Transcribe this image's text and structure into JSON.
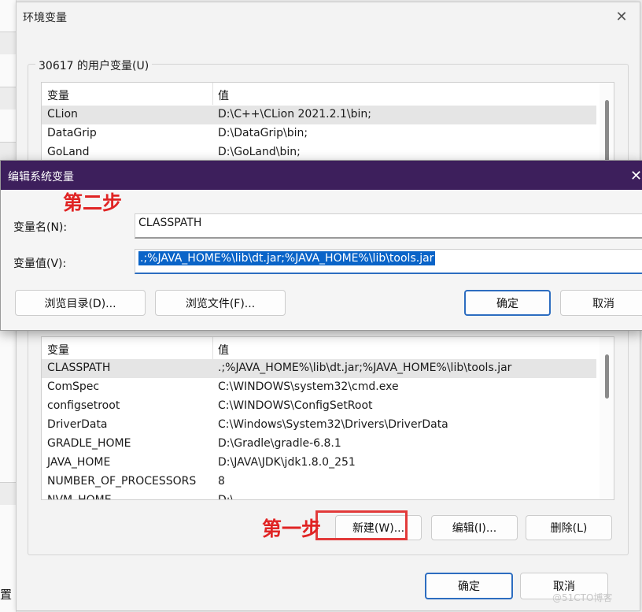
{
  "background": {
    "fragment_text": "置"
  },
  "env_dialog": {
    "title": "环境变量",
    "close_glyph": "✕",
    "user_group_label": "30617 的用户变量(U)",
    "user_table": {
      "headers": [
        "变量",
        "值"
      ],
      "rows": [
        {
          "name": "CLion",
          "value": "D:\\C++\\CLion 2021.2.1\\bin;"
        },
        {
          "name": "DataGrip",
          "value": "D:\\DataGrip\\bin;"
        },
        {
          "name": "GoLand",
          "value": "D:\\GoLand\\bin;"
        }
      ]
    },
    "system_table": {
      "headers": [
        "变量",
        "值"
      ],
      "rows": [
        {
          "name": "CLASSPATH",
          "value": ".;%JAVA_HOME%\\lib\\dt.jar;%JAVA_HOME%\\lib\\tools.jar"
        },
        {
          "name": "ComSpec",
          "value": "C:\\WINDOWS\\system32\\cmd.exe"
        },
        {
          "name": "configsetroot",
          "value": "C:\\WINDOWS\\ConfigSetRoot"
        },
        {
          "name": "DriverData",
          "value": "C:\\Windows\\System32\\Drivers\\DriverData"
        },
        {
          "name": "GRADLE_HOME",
          "value": "D:\\Gradle\\gradle-6.8.1"
        },
        {
          "name": "JAVA_HOME",
          "value": "D:\\JAVA\\JDK\\jdk1.8.0_251"
        },
        {
          "name": "NUMBER_OF_PROCESSORS",
          "value": "8"
        },
        {
          "name": "NVM_HOME",
          "value": "D:\\"
        }
      ]
    },
    "buttons": {
      "new": "新建(W)...",
      "edit": "编辑(I)...",
      "delete": "删除(L)",
      "ok": "确定",
      "cancel": "取消"
    }
  },
  "edit_dialog": {
    "title": "编辑系统变量",
    "close_glyph": "✕",
    "name_label": "变量名(N):",
    "name_value": "CLASSPATH",
    "value_label": "变量值(V):",
    "value_value": ".;%JAVA_HOME%\\lib\\dt.jar;%JAVA_HOME%\\lib\\tools.jar",
    "buttons": {
      "browse_dir": "浏览目录(D)...",
      "browse_file": "浏览文件(F)...",
      "ok": "确定",
      "cancel": "取消"
    }
  },
  "annotations": {
    "step1": "第一步",
    "step2": "第二步",
    "highlight_color": "#e23a3a"
  },
  "watermark": "@51CTO博客",
  "colors": {
    "title_bar": "#3d1f5c",
    "selection": "#0a64c8",
    "primary_border": "#2d6dc0"
  }
}
